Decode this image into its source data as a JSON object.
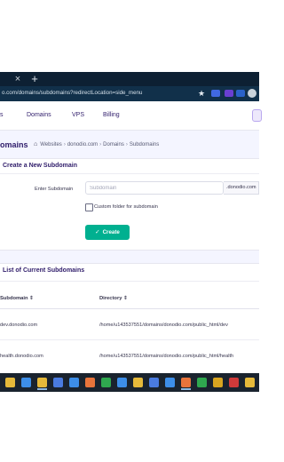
{
  "browser": {
    "new_tab_glyph": "+",
    "tab_close_glyph": "×",
    "url": "o.com/domains/subdomains?redirectLocation=side_menu"
  },
  "nav": {
    "items": [
      "s",
      "Domains",
      "VPS",
      "Billing"
    ]
  },
  "page": {
    "title": "omains",
    "breadcrumb": [
      "Websites",
      "donodio.com",
      "Domains",
      "Subdomains"
    ]
  },
  "create_card": {
    "title": "Create a New Subdomain",
    "label": "Enter Subdomain",
    "placeholder": "Subdomain",
    "domain_suffix": ".donodio.com",
    "checkbox_label": "Custom folder for subdomain",
    "button_label": "Create"
  },
  "list_card": {
    "title": "List of Current Subdomains",
    "columns": [
      "Subdomain ⇕",
      "Directory ⇕"
    ],
    "rows": [
      [
        "dev.donodio.com",
        "/home/u143537551/domains/donodio.com/public_html/dev"
      ],
      [
        "health.donodio.com",
        "/home/u143537551/domains/donodio.com/public_html/health"
      ]
    ]
  },
  "taskbar": {
    "icon_colors": [
      "#e6b93a",
      "#3d8ee8",
      "#e6b93a",
      "#4a7be0",
      "#3d8ee8",
      "#e8743b",
      "#2fa84f",
      "#3d8ee8",
      "#e6b93a",
      "#4a7be0",
      "#3d8ee8",
      "#e8743b",
      "#2fa84f",
      "#d9a520",
      "#d03a3a",
      "#e6b93a"
    ]
  },
  "colors": {
    "accent": "#00b090",
    "brand": "#2f1c6a",
    "page_bg": "#f4f5ff"
  }
}
